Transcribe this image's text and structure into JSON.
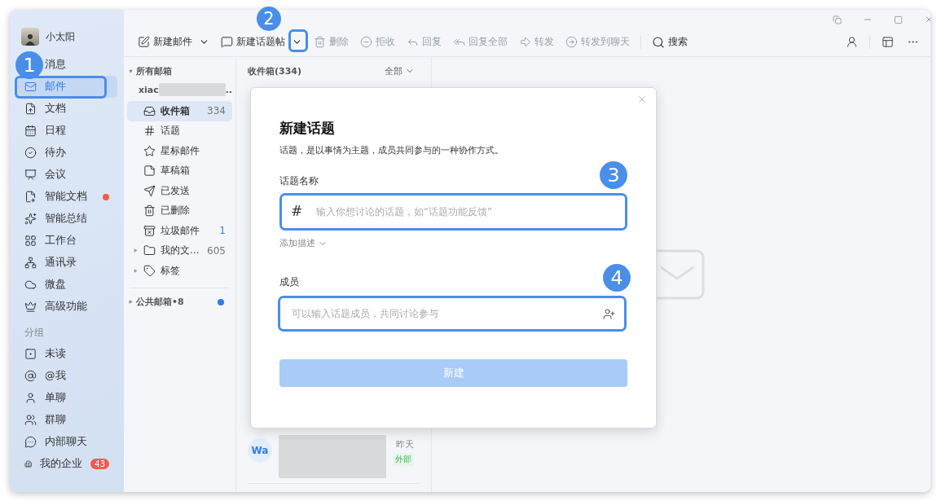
{
  "user": {
    "name": "小太阳"
  },
  "nav": [
    {
      "label": "消息",
      "selected": false,
      "dot": false
    },
    {
      "label": "邮件",
      "selected": true,
      "dot": false
    },
    {
      "label": "文档",
      "selected": false,
      "dot": false
    },
    {
      "label": "日程",
      "selected": false,
      "dot": false
    },
    {
      "label": "待办",
      "selected": false,
      "dot": false
    },
    {
      "label": "会议",
      "selected": false,
      "dot": false
    },
    {
      "label": "智能文档",
      "selected": false,
      "dot": true
    },
    {
      "label": "智能总结",
      "selected": false,
      "dot": false
    },
    {
      "label": "工作台",
      "selected": false,
      "dot": false
    },
    {
      "label": "通讯录",
      "selected": false,
      "dot": false
    },
    {
      "label": "微盘",
      "selected": false,
      "dot": false
    },
    {
      "label": "高级功能",
      "selected": false,
      "dot": false
    }
  ],
  "group_heading": "分组",
  "groups": [
    "未读",
    "@我",
    "单聊",
    "群聊",
    "内部聊天"
  ],
  "enterprise": {
    "label": "我的企业",
    "badge": "43"
  },
  "toolbar": {
    "actions": [
      {
        "label": "新建邮件",
        "disabled": false,
        "dropdown": true
      },
      {
        "label": "新建话题帖",
        "disabled": false,
        "dropdown": true
      },
      {
        "label": "删除",
        "disabled": true,
        "dropdown": false
      },
      {
        "label": "拒收",
        "disabled": true,
        "dropdown": false
      },
      {
        "label": "回复",
        "disabled": true,
        "dropdown": false
      },
      {
        "label": "回复全部",
        "disabled": true,
        "dropdown": false
      },
      {
        "label": "转发",
        "disabled": true,
        "dropdown": false
      },
      {
        "label": "转发到聊天",
        "disabled": true,
        "dropdown": false
      }
    ],
    "search": "搜索"
  },
  "folders": {
    "heading": "所有邮箱",
    "account": {
      "prefix": "xiac",
      "suffix": ".."
    },
    "items": [
      {
        "label": "收件箱",
        "count": "334",
        "selected": true,
        "expandable": false,
        "unread_count": false
      },
      {
        "label": "话题",
        "selected": false,
        "expandable": false
      },
      {
        "label": "星标邮件",
        "selected": false,
        "expandable": false
      },
      {
        "label": "草稿箱",
        "selected": false,
        "expandable": false
      },
      {
        "label": "已发送",
        "selected": false,
        "expandable": false
      },
      {
        "label": "已删除",
        "selected": false,
        "expandable": false
      },
      {
        "label": "垃圾邮件",
        "count": "1",
        "selected": false,
        "expandable": false,
        "unread_count": true
      },
      {
        "label": "我的文...",
        "count": "605",
        "selected": false,
        "expandable": true,
        "unread_count": false
      },
      {
        "label": "标签",
        "selected": false,
        "expandable": true
      }
    ],
    "public": {
      "label": "公共邮箱•8",
      "unread": true
    }
  },
  "list": {
    "title": "收件箱(334)",
    "filter": "全部",
    "messages": [
      {
        "avatar": "Wa",
        "time": "昨天",
        "tag": "外部"
      }
    ]
  },
  "dialog": {
    "title": "新建话题",
    "description": "话题，是以事情为主题，成员共同参与的一种协作方式。",
    "name_label": "话题名称",
    "name_prefix": "#",
    "name_placeholder": "输入你想讨论的话题，如“话题功能反馈”",
    "add_description": "添加描述",
    "members_label": "成员",
    "members_placeholder": "可以输入话题成员，共同讨论参与",
    "submit": {
      "label": "新建",
      "disabled": true
    }
  },
  "annotations": [
    {
      "number": "1"
    },
    {
      "number": "2"
    },
    {
      "number": "3"
    },
    {
      "number": "4"
    }
  ]
}
